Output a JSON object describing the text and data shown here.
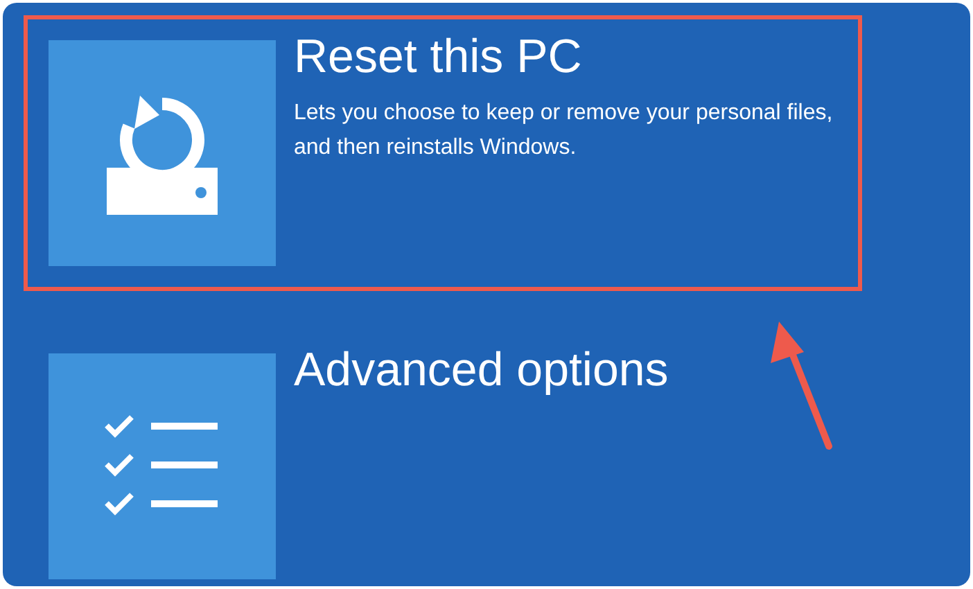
{
  "options": [
    {
      "kind": "reset",
      "title": "Reset this PC",
      "description": "Lets you choose to keep or remove your personal files, and then reinstalls Windows.",
      "selected": true
    },
    {
      "kind": "advanced",
      "title": "Advanced options",
      "selected": false
    }
  ]
}
